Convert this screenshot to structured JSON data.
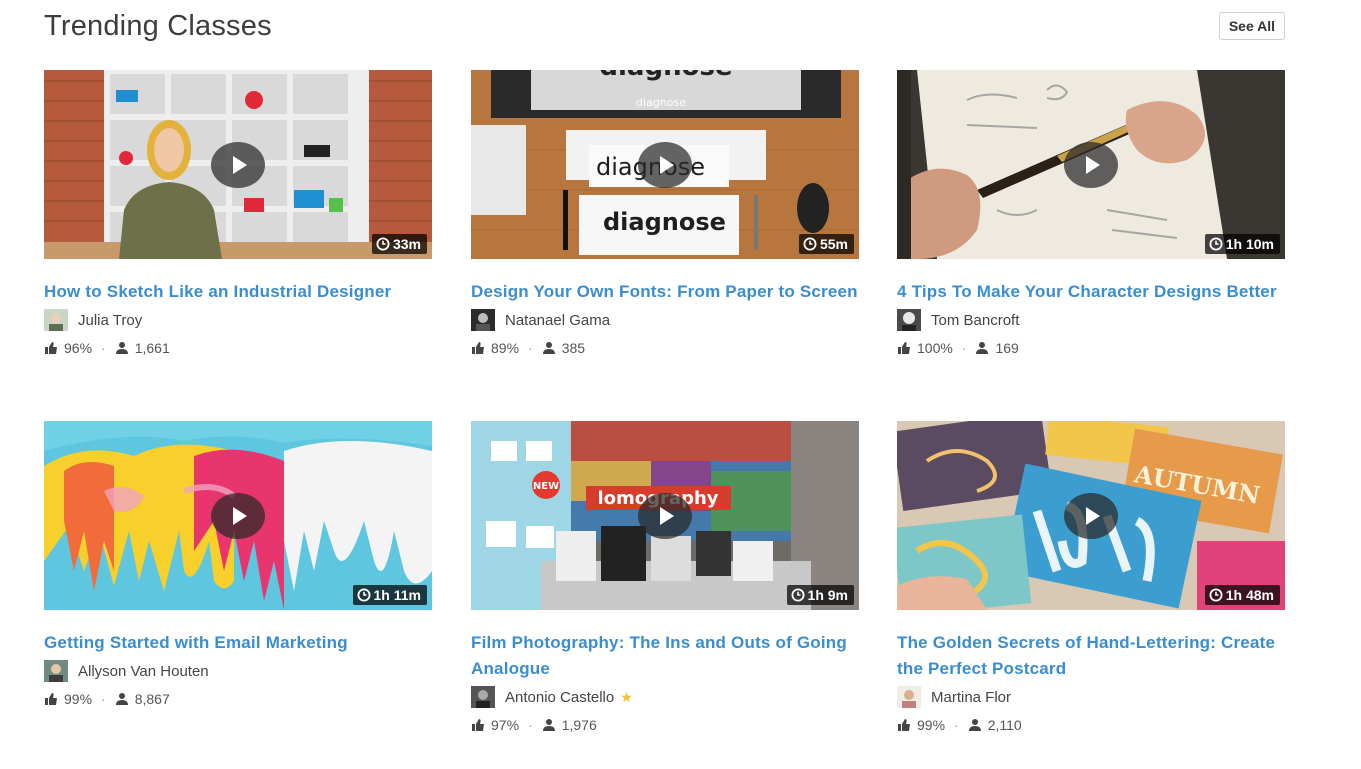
{
  "header": {
    "title": "Trending Classes",
    "see_all": "See All"
  },
  "classes": [
    {
      "title": "How to Sketch Like an Industrial Designer",
      "teacher": "Julia Troy",
      "featured": false,
      "rating": "96%",
      "students": "1,661",
      "duration": "33m"
    },
    {
      "title": "Design Your Own Fonts: From Paper to Screen",
      "teacher": "Natanael Gama",
      "featured": false,
      "rating": "89%",
      "students": "385",
      "duration": "55m"
    },
    {
      "title": "4 Tips To Make Your Character Designs Better",
      "teacher": "Tom Bancroft",
      "featured": false,
      "rating": "100%",
      "students": "169",
      "duration": "1h 10m"
    },
    {
      "title": "Getting Started with Email Marketing",
      "teacher": "Allyson Van Houten",
      "featured": false,
      "rating": "99%",
      "students": "8,867",
      "duration": "1h 11m"
    },
    {
      "title": "Film Photography: The Ins and Outs of Going Analogue",
      "teacher": "Antonio Castello",
      "featured": true,
      "star": "★",
      "rating": "97%",
      "students": "1,976",
      "duration": "1h 9m"
    },
    {
      "title": "The Golden Secrets of Hand-Lettering: Create the Perfect Postcard",
      "teacher": "Martina Flor",
      "featured": false,
      "rating": "99%",
      "students": "2,110",
      "duration": "1h 48m"
    }
  ],
  "thumb_words": {
    "fonts_screen": "diagnose",
    "fonts_card": "diagnose",
    "film_banner": "lomography",
    "film_badge": "NEW",
    "lettering_card": "AUTUMN"
  },
  "colors": {
    "link": "#3a8dd1",
    "star": "#f5c02c",
    "text": "#444444"
  }
}
